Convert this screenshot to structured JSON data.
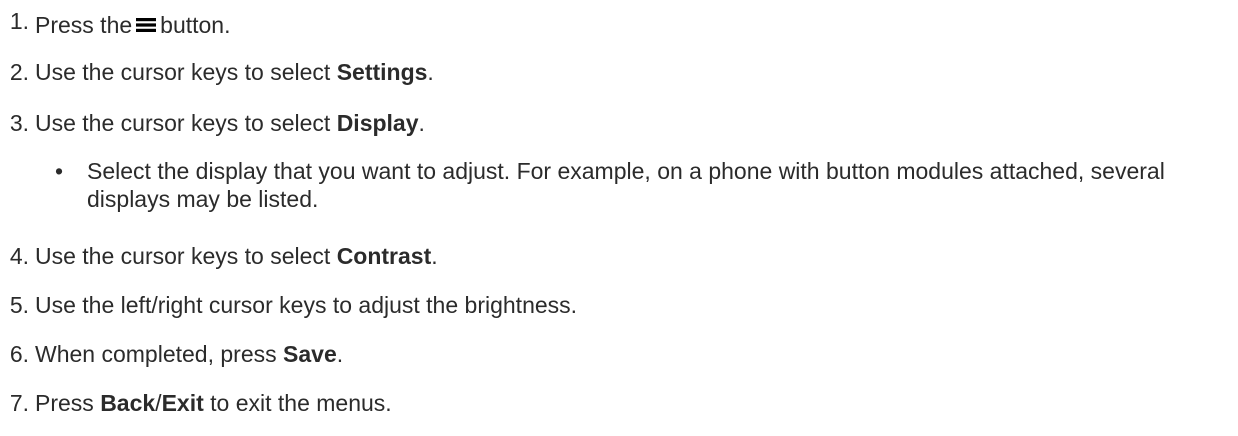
{
  "steps": [
    {
      "num": "1.",
      "pre": "Press the",
      "post": "button.",
      "icon": "menu-icon"
    },
    {
      "num": "2.",
      "pre": "Use the cursor keys to select ",
      "bold": "Settings",
      "post": "."
    },
    {
      "num": "3.",
      "pre": "Use the cursor keys to select ",
      "bold": "Display",
      "post": "."
    },
    {
      "num": "4.",
      "pre": "Use the cursor keys to select ",
      "bold": "Contrast",
      "post": "."
    },
    {
      "num": "5.",
      "pre": "Use the left/right cursor keys to adjust the brightness."
    },
    {
      "num": "6.",
      "pre": "When completed, press ",
      "bold": "Save",
      "post": "."
    },
    {
      "num": "7.",
      "pre": "Press ",
      "bold": "Back",
      "mid": "/",
      "bold2": "Exit",
      "post": " to exit the menus."
    }
  ],
  "substep": {
    "bullet": "•",
    "text": "Select the display that you want to adjust. For example, on a phone with button modules attached, several displays may be listed."
  }
}
